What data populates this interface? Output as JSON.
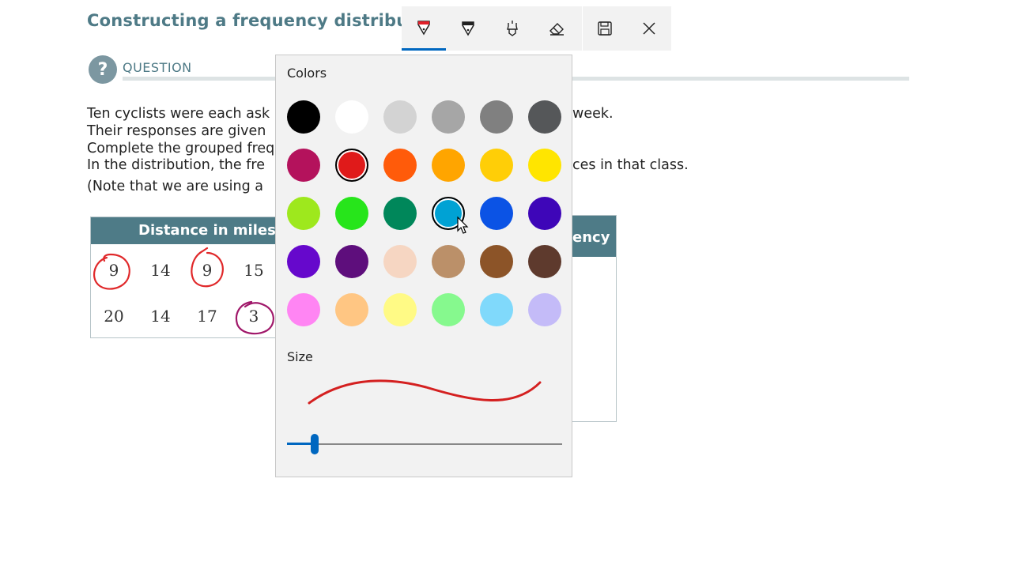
{
  "page": {
    "title": "Constructing a frequency distribut",
    "question_label": "QUESTION",
    "question_icon": "question-mark-icon",
    "paragraphs": [
      "Ten cyclists were each ask",
      "Their responses are given",
      "Complete the grouped freq",
      "In the distribution, the fre",
      "(Note that we are using a"
    ],
    "paragraph_tails": [
      "week.",
      "ces in that class."
    ]
  },
  "table": {
    "header": "Distance in miles",
    "rows": [
      [
        "9",
        "14",
        "9",
        "15"
      ],
      [
        "20",
        "14",
        "17",
        "3"
      ]
    ],
    "frequency_header": "ency"
  },
  "toolbar": {
    "tools": [
      {
        "name": "ballpoint-pen",
        "icon": "pen-icon",
        "active": true
      },
      {
        "name": "pencil",
        "icon": "pencil-icon",
        "active": false
      },
      {
        "name": "highlighter",
        "icon": "highlighter-icon",
        "active": false
      },
      {
        "name": "eraser",
        "icon": "eraser-icon",
        "active": false
      }
    ],
    "save_icon": "save-icon",
    "close_icon": "close-icon",
    "accent": "#0067c0"
  },
  "pen_panel": {
    "colors_label": "Colors",
    "size_label": "Size",
    "selected_color": "#e01a1a",
    "hovered_color": "#00a2d4",
    "palette": [
      [
        "#000000",
        "#ffffff",
        "#d3d3d3",
        "#a6a6a6",
        "#808080",
        "#555759"
      ],
      [
        "#b4125c",
        "#e01a1a",
        "#ff5b0a",
        "#ffa500",
        "#ffce07",
        "#ffe500"
      ],
      [
        "#9ee81d",
        "#27e51b",
        "#00875a",
        "#00a2d4",
        "#0b53e5",
        "#3e06b8"
      ],
      [
        "#6608cc",
        "#5e0e7c",
        "#f6d6c2",
        "#bb9069",
        "#8c5428",
        "#5e3a2d"
      ],
      [
        "#ff85f3",
        "#ffc683",
        "#fffa85",
        "#86f98e",
        "#80d9fb",
        "#c4bbf8"
      ]
    ],
    "size_value": 0.1,
    "preview_color": "#d42020"
  }
}
